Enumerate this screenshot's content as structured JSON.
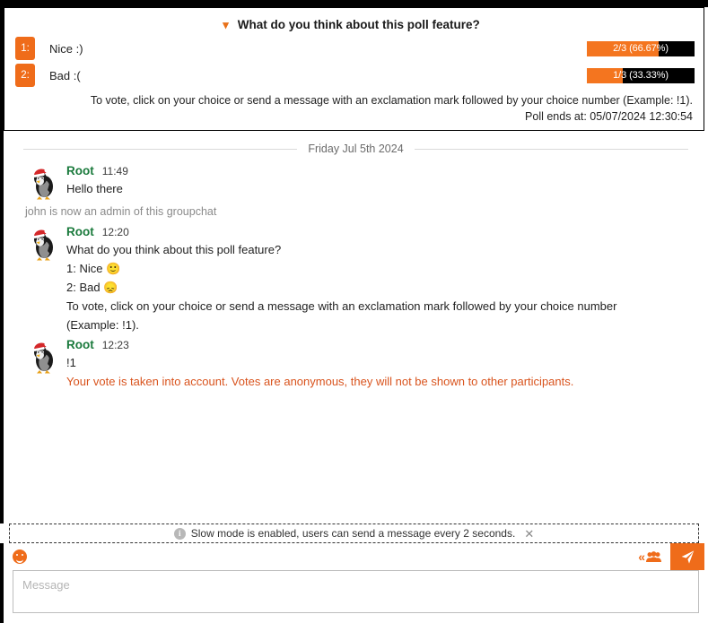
{
  "poll": {
    "chevron_icon": "chevron-down-icon",
    "title": "What do you think about this poll feature?",
    "options": [
      {
        "number": "1:",
        "label": "Nice :)",
        "votes": "2/3",
        "percent_text": "(66.67%)",
        "percent": 66.67
      },
      {
        "number": "2:",
        "label": "Bad :(",
        "votes": "1/3",
        "percent_text": "(33.33%)",
        "percent": 33.33
      }
    ],
    "instructions": "To vote, click on your choice or send a message with an exclamation mark followed by your choice number (Example: !1).",
    "ends_at": "Poll ends at: 05/07/2024 12:30:54",
    "accent_color": "#ef6c1a",
    "bar_bg_color": "#000000"
  },
  "conversation": {
    "date_separator": "Friday Jul 5th 2024",
    "system_message": "john is now an admin of this groupchat",
    "author_color": "#1a7a3c",
    "messages": [
      {
        "author": "Root",
        "time": "11:49",
        "lines": [
          "Hello there"
        ]
      },
      {
        "author": "Root",
        "time": "12:20",
        "lines": [
          "What do you think about this poll feature?",
          "1: Nice 🙂",
          "2: Bad 😞",
          "To vote, click on your choice or send a message with an exclamation mark followed by your choice number (Example: !1)."
        ]
      },
      {
        "author": "Root",
        "time": "12:23",
        "lines": [
          "!1"
        ],
        "note": "Your vote is taken into account. Votes are anonymous, they will not be shown to other participants.",
        "note_color": "#d9541e"
      }
    ]
  },
  "slow_mode": {
    "icon": "info-icon",
    "text": "Slow mode is enabled, users can send a message every 2 seconds.",
    "close_label": "✕"
  },
  "composer": {
    "emoji_button": "emoji-smiley-icon",
    "collapse_icon": "chevron-double-left-icon",
    "participants_icon": "people-group-icon",
    "send_icon": "send-paper-plane-icon",
    "input_placeholder": "Message",
    "input_value": ""
  }
}
